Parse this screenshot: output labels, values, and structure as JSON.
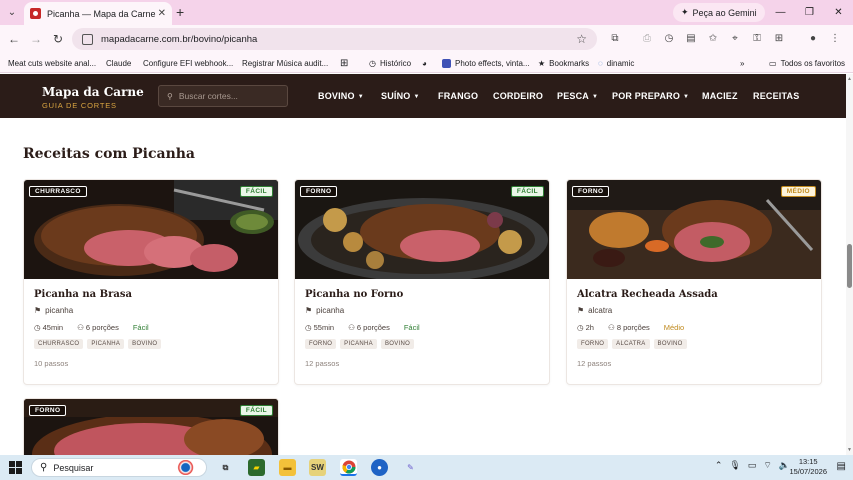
{
  "browser": {
    "tab_title": "Picanha — Mapa da Carne",
    "tab_close": "✕",
    "new_tab": "+",
    "gemini_label": "Peça ao Gemini",
    "url": "mapadacarne.com.br/bovino/picanha",
    "window_controls": [
      "—",
      "❐",
      "✕"
    ]
  },
  "bookmarks": [
    {
      "label": "Meat cuts website anal...",
      "color": "#d84315"
    },
    {
      "label": "Claude",
      "color": "#d97757"
    },
    {
      "label": "Configure EFI webhook...",
      "color": "#6a6a6a"
    },
    {
      "label": "Registrar Música audit...",
      "color": "#e0e0e0"
    },
    {
      "label": "Histórico",
      "color": "#555555"
    },
    {
      "label": "Photo effects, vinta...",
      "color": "#3f51b5"
    },
    {
      "label": "Bookmarks",
      "color": "#202124"
    },
    {
      "label": "dinamic",
      "color": "#1565c0"
    },
    {
      "label": "Todos os favoritos",
      "color": "#555555"
    }
  ],
  "site": {
    "logo_title": "Mapa da Carne",
    "logo_subtitle": "GUIA DE CORTES",
    "search_placeholder": "Buscar cortes...",
    "nav": [
      "BOVINO",
      "SUÍNO",
      "FRANGO",
      "CORDEIRO",
      "PESCA",
      "POR PREPARO",
      "MACIEZ",
      "RECEITAS"
    ],
    "accent_color": "#d9a441",
    "header_color": "#2b1c18"
  },
  "section_title": "Receitas com Picanha",
  "recipes": [
    {
      "category": "CHURRASCO",
      "difficulty_badge": "FÁCIL",
      "name": "Picanha na Brasa",
      "cut": "picanha",
      "time": "45min",
      "servings": "6 porções",
      "difficulty": "Fácil",
      "tags": [
        "CHURRASCO",
        "PICANHA",
        "BOVINO"
      ],
      "steps": "10 passos"
    },
    {
      "category": "FORNO",
      "difficulty_badge": "FÁCIL",
      "name": "Picanha no Forno",
      "cut": "picanha",
      "time": "55min",
      "servings": "6 porções",
      "difficulty": "Fácil",
      "tags": [
        "FORNO",
        "PICANHA",
        "BOVINO"
      ],
      "steps": "12 passos"
    },
    {
      "category": "FORNO",
      "difficulty_badge": "MÉDIO",
      "name": "Alcatra Recheada Assada",
      "cut": "alcatra",
      "time": "2h",
      "servings": "8 porções",
      "difficulty": "Médio",
      "tags": [
        "FORNO",
        "ALCATRA",
        "BOVINO"
      ],
      "steps": "12 passos"
    },
    {
      "category": "FORNO",
      "difficulty_badge": "FÁCIL"
    }
  ],
  "taskbar": {
    "search_label": "Pesquisar",
    "time": "13:15",
    "date": "15/07/2026"
  }
}
